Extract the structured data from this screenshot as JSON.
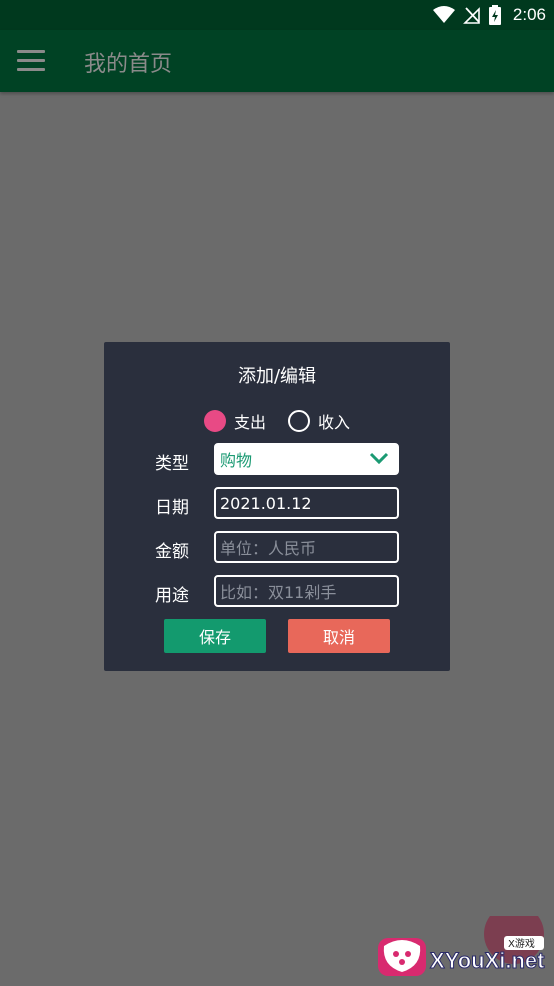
{
  "status_bar": {
    "time": "2:06"
  },
  "app_bar": {
    "title": "我的首页"
  },
  "dialog": {
    "title": "添加/编辑",
    "radio": {
      "expense_label": "支出",
      "income_label": "收入",
      "selected": "支出"
    },
    "type": {
      "label": "类型",
      "value": "购物"
    },
    "date": {
      "label": "日期",
      "value": "2021.01.12"
    },
    "amount": {
      "label": "金额",
      "placeholder": "单位：人民币"
    },
    "usage": {
      "label": "用途",
      "placeholder": "比如：双11剁手"
    },
    "save_label": "保存",
    "cancel_label": "取消"
  },
  "watermark": {
    "text": "XYouXi.net",
    "badge": "X游戏"
  },
  "colors": {
    "status_bar": "#00391e",
    "app_bar": "#004224",
    "dialog_bg": "#2a2f3d",
    "radio_checked": "#e84a85",
    "save_button": "#139a6e",
    "cancel_button": "#e8685a",
    "select_text": "#1b9a73"
  }
}
